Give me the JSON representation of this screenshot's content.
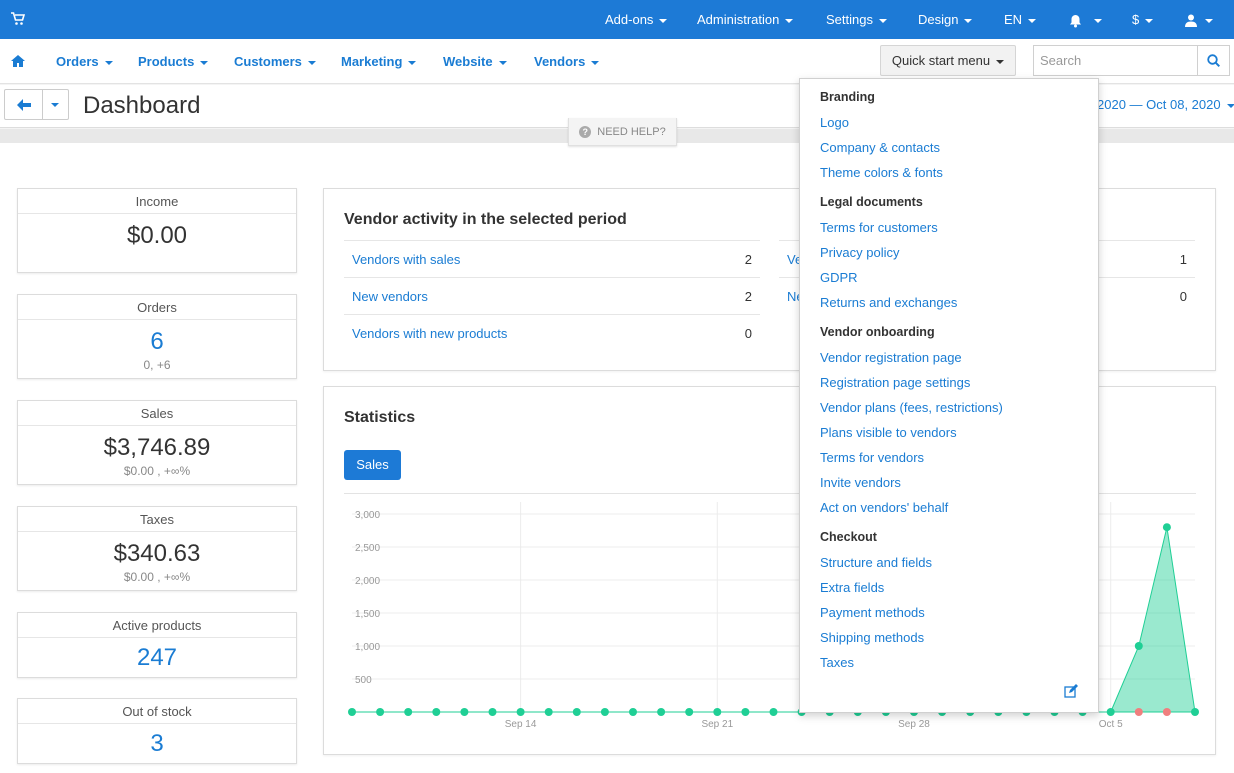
{
  "topbar": {
    "cart_icon": "cart-icon",
    "menus": [
      {
        "label": "Add-ons"
      },
      {
        "label": "Administration"
      },
      {
        "label": "Settings"
      },
      {
        "label": "Design"
      },
      {
        "label": "EN"
      }
    ],
    "currency": "$",
    "bell_icon": "bell-icon",
    "user_icon": "user-icon"
  },
  "nav": {
    "home_icon": "home-icon",
    "items": [
      {
        "label": "Orders"
      },
      {
        "label": "Products"
      },
      {
        "label": "Customers"
      },
      {
        "label": "Marketing"
      },
      {
        "label": "Website"
      },
      {
        "label": "Vendors"
      }
    ],
    "quick_start": "Quick start menu",
    "search_placeholder": "Search"
  },
  "header": {
    "title": "Dashboard",
    "date_range": "2020 — Oct 08, 2020",
    "need_help": "NEED HELP?"
  },
  "cards": [
    {
      "title": "Income",
      "value": "$0.00",
      "sub": ""
    },
    {
      "title": "Orders",
      "value": "6",
      "sub": "0, +6"
    },
    {
      "title": "Sales",
      "value": "$3,746.89",
      "sub": "$0.00 , +∞%"
    },
    {
      "title": "Taxes",
      "value": "$340.63",
      "sub": "$0.00 , +∞%"
    },
    {
      "title": "Active products",
      "value": "247",
      "sub": ""
    },
    {
      "title": "Out of stock",
      "value": "3",
      "sub": ""
    }
  ],
  "vendor_activity": {
    "title": "Vendor activity in the selected period",
    "left_rows": [
      {
        "label": "Vendors with sales",
        "value": "2"
      },
      {
        "label": "New vendors",
        "value": "2"
      },
      {
        "label": "Vendors with new products",
        "value": "0"
      }
    ],
    "right_rows": [
      {
        "label": "Ve",
        "value": "1"
      },
      {
        "label": "Ne",
        "value": "0"
      }
    ]
  },
  "statistics": {
    "title": "Statistics",
    "tab": "Sales"
  },
  "chart_data": {
    "type": "area",
    "yticks": [
      "3,000",
      "2,500",
      "2,000",
      "1,500",
      "1,000",
      "500"
    ],
    "ylim": [
      0,
      3000
    ],
    "xticks": [
      "Sep 14",
      "Sep 21",
      "Sep 28",
      "Oct 5"
    ],
    "grid": true,
    "series": [
      {
        "color": "#1fcf95",
        "values": [
          0,
          0,
          0,
          0,
          0,
          0,
          0,
          0,
          0,
          0,
          0,
          0,
          0,
          0,
          0,
          0,
          0,
          0,
          0,
          0,
          0,
          0,
          0,
          0,
          0,
          0,
          0,
          0,
          1000,
          2800,
          0
        ]
      },
      {
        "color": "#f07f7f",
        "values": [
          0,
          0,
          0,
          0,
          0,
          0,
          0,
          0,
          0,
          0,
          0,
          0,
          0,
          0,
          0,
          0,
          0,
          0,
          0,
          0,
          0,
          0,
          0,
          0,
          0,
          0,
          0,
          0,
          0,
          0,
          0
        ]
      }
    ]
  },
  "quick_menu": {
    "sections": [
      {
        "title": "Branding",
        "links": [
          "Logo",
          "Company & contacts",
          "Theme colors & fonts"
        ]
      },
      {
        "title": "Legal documents",
        "links": [
          "Terms for customers",
          "Privacy policy",
          "GDPR",
          "Returns and exchanges"
        ]
      },
      {
        "title": "Vendor onboarding",
        "links": [
          "Vendor registration page",
          "Registration page settings",
          "Vendor plans (fees, restrictions)",
          "Plans visible to vendors",
          "Terms for vendors",
          "Invite vendors",
          "Act on vendors' behalf"
        ]
      },
      {
        "title": "Checkout",
        "links": [
          "Structure and fields",
          "Extra fields",
          "Payment methods",
          "Shipping methods",
          "Taxes"
        ]
      }
    ],
    "edit_icon": "edit-icon"
  }
}
